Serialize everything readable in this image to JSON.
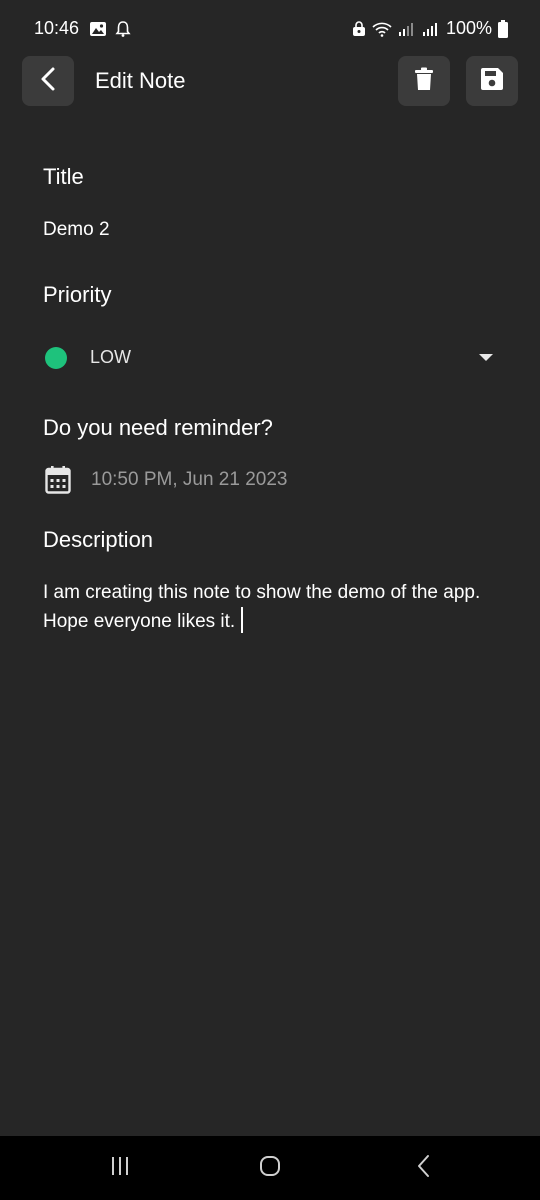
{
  "status_bar": {
    "time": "10:46",
    "battery": "100%"
  },
  "app_bar": {
    "title": "Edit Note",
    "back_icon": "chevron-left-icon",
    "delete_icon": "trash-icon",
    "save_icon": "floppy-disk-icon"
  },
  "form": {
    "title_label": "Title",
    "title_value": "Demo 2",
    "priority_label": "Priority",
    "priority_value": "LOW",
    "priority_color": "#1ec27c",
    "reminder_label": "Do you need reminder?",
    "reminder_value": "10:50 PM, Jun 21 2023",
    "description_label": "Description",
    "description_value": "I am creating this note to show the demo of the app.  Hope everyone likes it."
  },
  "colors": {
    "background": "#262626",
    "button_bg": "#3b3b3b",
    "accent_green": "#1ec27c",
    "muted_text": "#9a9a9a"
  },
  "nav_bar": {
    "recent_icon": "recent-apps-icon",
    "home_icon": "home-icon",
    "back_icon": "back-icon"
  }
}
